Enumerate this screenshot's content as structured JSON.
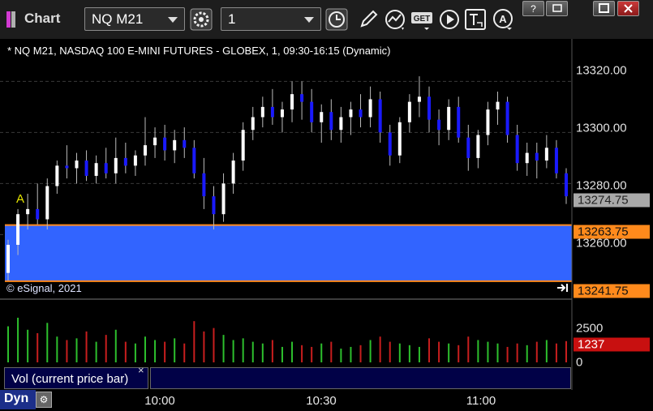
{
  "app": {
    "title": "Chart",
    "icon": "chart-logo-icon"
  },
  "toolbar": {
    "symbol_value": "NQ M21",
    "interval_value": "1",
    "buttons": [
      "settings-gear-icon",
      "clock-icon",
      "pencil-icon",
      "study-icon",
      "get-icon",
      "play-icon",
      "text-icon",
      "alert-icon"
    ]
  },
  "window": {
    "buttons": [
      "help-icon",
      "restore-icon",
      "maximize-icon",
      "close-icon"
    ]
  },
  "chart": {
    "header": "* NQ M21, NASDAQ 100 E-MINI FUTURES - GLOBEX, 1, 09:30-16:15 (Dynamic)",
    "copyright": "© eSignal, 2021",
    "annotation": "A",
    "price_ticks": [
      "13320.00",
      "13300.00",
      "13280.00",
      "13260.00"
    ],
    "current_price": "13274.75",
    "zone_upper": "13263.75",
    "zone_lower": "13241.75",
    "zone_color": "#3264ff",
    "time_labels": [
      "10:00",
      "10:30",
      "11:00"
    ],
    "volume": {
      "label": "Vol (current price bar)",
      "ticks": [
        "2500",
        "0"
      ],
      "current": "1237",
      "current_color": "#c81010"
    }
  },
  "chart_data": {
    "type": "candlestick",
    "y_range": [
      13236,
      13336
    ],
    "y_ticks": [
      13320,
      13300,
      13280,
      13260
    ],
    "x_ticks": [
      "10:00",
      "10:30",
      "11:00"
    ],
    "candles_ohlc": [
      [
        13245,
        13258,
        13242,
        13256
      ],
      [
        13256,
        13270,
        13252,
        13268
      ],
      [
        13268,
        13276,
        13262,
        13270
      ],
      [
        13270,
        13280,
        13264,
        13266
      ],
      [
        13266,
        13282,
        13262,
        13279
      ],
      [
        13279,
        13289,
        13276,
        13287
      ],
      [
        13287,
        13295,
        13282,
        13286
      ],
      [
        13286,
        13292,
        13280,
        13289
      ],
      [
        13289,
        13293,
        13281,
        13283
      ],
      [
        13283,
        13291,
        13280,
        13288
      ],
      [
        13288,
        13294,
        13282,
        13284
      ],
      [
        13284,
        13298,
        13280,
        13290
      ],
      [
        13290,
        13296,
        13284,
        13287
      ],
      [
        13287,
        13293,
        13283,
        13291
      ],
      [
        13291,
        13306,
        13287,
        13295
      ],
      [
        13295,
        13302,
        13290,
        13298
      ],
      [
        13298,
        13303,
        13289,
        13293
      ],
      [
        13293,
        13301,
        13288,
        13297
      ],
      [
        13297,
        13302,
        13290,
        13294
      ],
      [
        13294,
        13297,
        13282,
        13284
      ],
      [
        13284,
        13290,
        13270,
        13275
      ],
      [
        13275,
        13279,
        13262,
        13268
      ],
      [
        13268,
        13284,
        13265,
        13280
      ],
      [
        13280,
        13292,
        13276,
        13289
      ],
      [
        13289,
        13304,
        13285,
        13301
      ],
      [
        13301,
        13310,
        13297,
        13306
      ],
      [
        13306,
        13314,
        13302,
        13310
      ],
      [
        13310,
        13317,
        13303,
        13306
      ],
      [
        13306,
        13312,
        13300,
        13309
      ],
      [
        13309,
        13320,
        13304,
        13315
      ],
      [
        13315,
        13320,
        13305,
        13312
      ],
      [
        13312,
        13317,
        13300,
        13304
      ],
      [
        13304,
        13311,
        13296,
        13308
      ],
      [
        13308,
        13313,
        13297,
        13301
      ],
      [
        13301,
        13310,
        13296,
        13306
      ],
      [
        13306,
        13312,
        13299,
        13309
      ],
      [
        13309,
        13315,
        13302,
        13306
      ],
      [
        13306,
        13318,
        13302,
        13313
      ],
      [
        13313,
        13316,
        13296,
        13300
      ],
      [
        13300,
        13303,
        13287,
        13291
      ],
      [
        13291,
        13306,
        13288,
        13304
      ],
      [
        13304,
        13315,
        13300,
        13312
      ],
      [
        13312,
        13322,
        13306,
        13314
      ],
      [
        13314,
        13318,
        13300,
        13305
      ],
      [
        13305,
        13309,
        13295,
        13301
      ],
      [
        13301,
        13313,
        13297,
        13310
      ],
      [
        13310,
        13314,
        13296,
        13298
      ],
      [
        13298,
        13303,
        13285,
        13290
      ],
      [
        13290,
        13301,
        13286,
        13299
      ],
      [
        13299,
        13312,
        13295,
        13309
      ],
      [
        13309,
        13316,
        13303,
        13312
      ],
      [
        13312,
        13314,
        13296,
        13299
      ],
      [
        13299,
        13303,
        13285,
        13288
      ],
      [
        13288,
        13296,
        13283,
        13292
      ],
      [
        13292,
        13296,
        13282,
        13289
      ],
      [
        13289,
        13299,
        13286,
        13294
      ],
      [
        13294,
        13297,
        13282,
        13284
      ],
      [
        13284,
        13286,
        13272,
        13275
      ]
    ],
    "volume_values": [
      2100,
      2600,
      1900,
      1700,
      2300,
      1500,
      1300,
      1400,
      1800,
      1200,
      1600,
      1900,
      1200,
      1100,
      1500,
      1300,
      1200,
      1400,
      1100,
      2400,
      1800,
      2000,
      1600,
      1300,
      1400,
      1200,
      1100,
      1300,
      900,
      1200,
      1000,
      900,
      1100,
      1200,
      800,
      900,
      1000,
      1300,
      1500,
      1200,
      1100,
      1000,
      900,
      1400,
      1200,
      1100,
      1000,
      1500,
      1300,
      1200,
      1100,
      900,
      1100,
      1000,
      1200,
      1300,
      1100,
      1237
    ]
  }
}
